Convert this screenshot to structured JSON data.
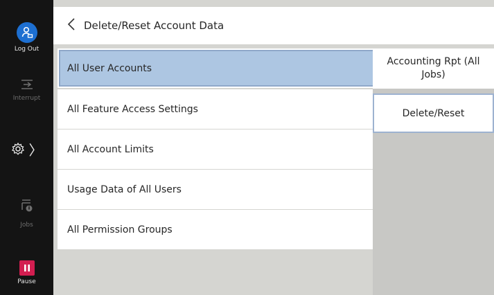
{
  "rail": {
    "logout_label": "Log Out",
    "interrupt_label": "Interrupt",
    "jobs_label": "Jobs",
    "pause_label": "Pause"
  },
  "header": {
    "title": "Delete/Reset Account Data"
  },
  "items": [
    {
      "label": "All User Accounts",
      "selected": true
    },
    {
      "label": "All Feature Access Settings"
    },
    {
      "label": "All Account Limits"
    },
    {
      "label": "Usage Data of All Users"
    },
    {
      "label": "All Permission Groups"
    }
  ],
  "right": {
    "report_button": "Accounting Rpt (All\nJobs)",
    "reset_button": "Delete/Reset"
  },
  "colors": {
    "selected": "#adc6e2",
    "logout": "#1d6fd1",
    "pause": "#d21e50"
  },
  "icons": [
    "user-logout-icon",
    "interrupt-icon",
    "gear-icon",
    "jobs-icon",
    "pause-icon",
    "chevron-left-icon"
  ]
}
